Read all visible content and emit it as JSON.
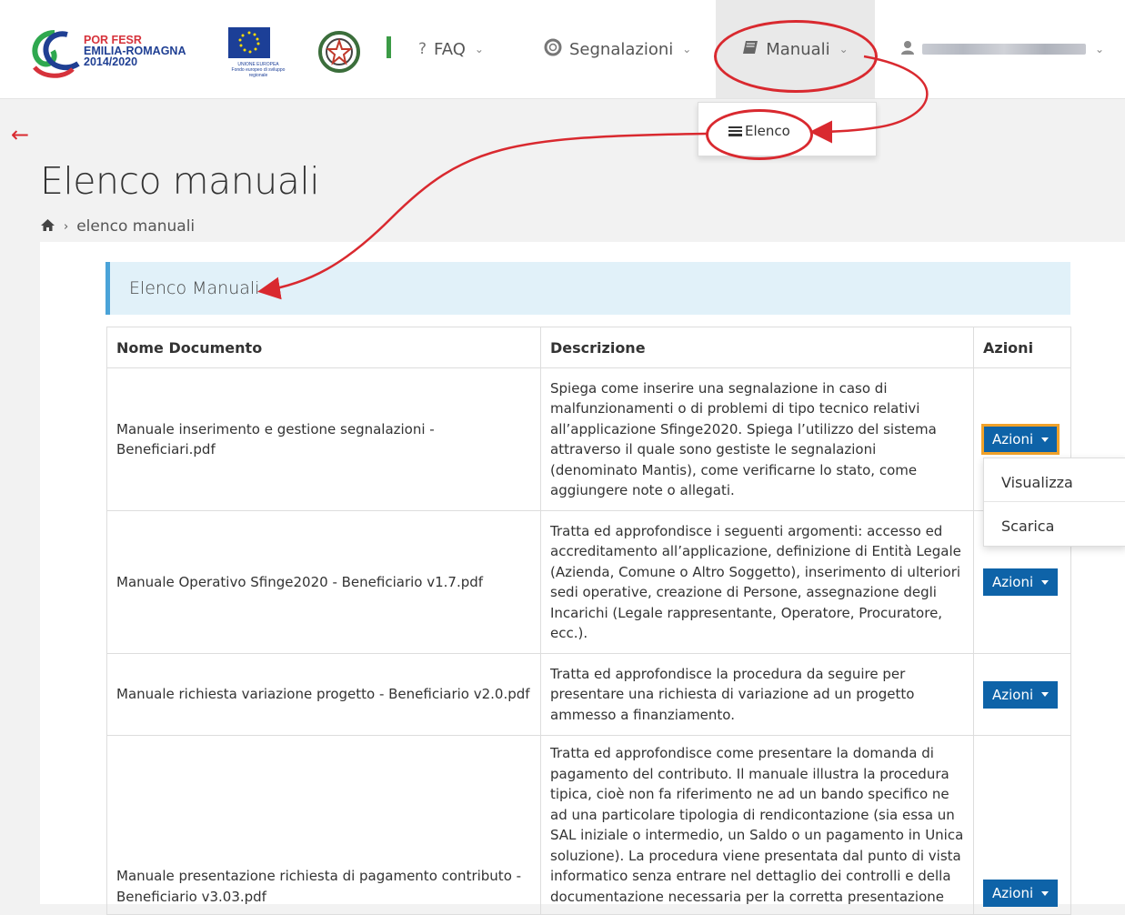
{
  "nav": {
    "logo_por_line1": "POR FESR",
    "logo_por_line2": "EMILIA-ROMAGNA",
    "logo_por_line3": "2014/2020",
    "logo_ue_caption1": "UNIONE EUROPEA",
    "logo_ue_caption2": "Fondo europeo di sviluppo regionale",
    "faq_label": "FAQ",
    "segnalazioni_label": "Segnalazioni",
    "manuali_label": "Manuali",
    "manuali_menu": {
      "elenco_label": "Elenco"
    }
  },
  "page": {
    "title": "Elenco manuali",
    "breadcrumb": "elenco manuali",
    "section_title": "Elenco Manuali"
  },
  "table": {
    "headers": {
      "name": "Nome Documento",
      "desc": "Descrizione",
      "actions": "Azioni"
    },
    "action_label": "Azioni",
    "rows": [
      {
        "name": "Manuale inserimento e gestione segnalazioni - Beneficiari.pdf",
        "desc": "Spiega come inserire una segnalazione in caso di malfunzionamenti o di problemi di tipo tecnico relativi all’applicazione Sfinge2020. Spiega l’utilizzo del sistema attraverso il quale sono gestiste le segnalazioni (denominato Mantis), come verificarne lo stato, come aggiungere note o allegati."
      },
      {
        "name": "Manuale Operativo Sfinge2020 - Beneficiario v1.7.pdf",
        "desc": "Tratta ed approfondisce i seguenti argomenti: accesso ed accreditamento all’applicazione, definizione di Entità Legale (Azienda, Comune o Altro Soggetto), inserimento di ulteriori sedi operative, creazione di Persone, assegnazione degli Incarichi (Legale rappresentante, Operatore, Procuratore, ecc.)."
      },
      {
        "name": "Manuale richiesta variazione progetto - Beneficiario v2.0.pdf",
        "desc": "Tratta ed approfondisce la procedura da seguire per presentare una richiesta di variazione ad un progetto ammesso a finanziamento."
      },
      {
        "name": "Manuale presentazione richiesta di pagamento contributo - Beneficiario v3.03.pdf",
        "desc": "Tratta ed approfondisce come presentare la domanda di pagamento del contributo. Il manuale illustra la procedura tipica, cioè non fa riferimento ne ad un bando specifico ne ad una particolare tipologia di rendicontazione (sia essa un SAL iniziale o intermedio, un Saldo o un pagamento in Unica soluzione). La procedura viene presentata dal punto di vista informatico senza entrare nel dettaglio dei controlli e della documentazione necessaria per la corretta presentazione"
      }
    ],
    "row_menu": {
      "view_label": "Visualizza",
      "download_label": "Scarica"
    }
  },
  "colors": {
    "accent_blue": "#0e63a8",
    "annotation_red": "#d9292f",
    "focus_orange": "#f0a22b",
    "section_bg": "#e1f1f9"
  }
}
